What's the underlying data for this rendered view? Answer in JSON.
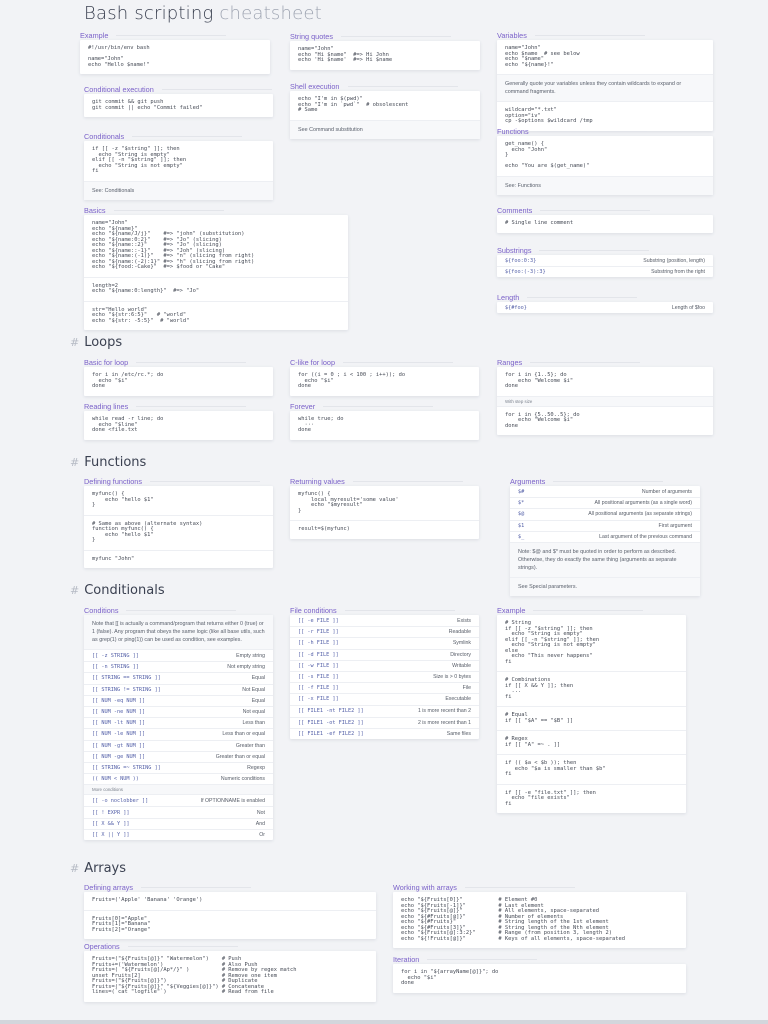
{
  "title": {
    "main": "Bash scripting",
    "sub": "cheatsheet"
  },
  "sections": {
    "hash": "#",
    "loops": "Loops",
    "functions": "Functions",
    "conditionals": "Conditionals",
    "arrays": "Arrays"
  },
  "cards": [
    {
      "id": "example",
      "title": "Example",
      "blocks": [
        {
          "type": "code",
          "lines": [
            "#!/usr/bin/env bash",
            "",
            "name=\"John\"",
            "echo \"Hello $name!\""
          ]
        }
      ]
    },
    {
      "id": "condexec",
      "title": "Conditional execution",
      "blocks": [
        {
          "type": "code",
          "lines": [
            "git commit && git push",
            "git commit || echo \"Commit failed\""
          ]
        }
      ]
    },
    {
      "id": "conditionals",
      "title": "Conditionals",
      "blocks": [
        {
          "type": "code",
          "lines": [
            "if [[ -z \"$string\" ]]; then",
            "  echo \"String is empty\"",
            "elif [[ -n \"$string\" ]]; then",
            "  echo \"String is not empty\"",
            "fi"
          ]
        },
        {
          "type": "text",
          "text": "See: Conditionals"
        }
      ]
    },
    {
      "id": "basics",
      "title": "Basics",
      "blocks": [
        {
          "type": "code",
          "lines": [
            "name=\"John\"",
            "echo \"${name}\"",
            "echo \"${name/J/j}\"    #=> \"john\" (substitution)",
            "echo \"${name:0:2}\"    #=> \"Jo\" (slicing)",
            "echo \"${name::2}\"     #=> \"Jo\" (slicing)",
            "echo \"${name::-1}\"    #=> \"Joh\" (slicing)",
            "echo \"${name:(-1)}\"   #=> \"n\" (slicing from right)",
            "echo \"${name:(-2):1}\" #=> \"h\" (slicing from right)",
            "echo \"${food:-Cake}\"  #=> $food or \"Cake\""
          ]
        },
        {
          "type": "code",
          "lines": [
            "length=2",
            "echo \"${name:0:length}\"  #=> \"Jo\""
          ]
        },
        {
          "type": "code",
          "lines": [
            "str=\"Hello world\"",
            "echo \"${str:6:5}\"   # \"world\"",
            "echo \"${str: -5:5}\"  # \"world\""
          ]
        }
      ]
    },
    {
      "id": "strquotes",
      "title": "String quotes",
      "blocks": [
        {
          "type": "code",
          "lines": [
            "name=\"John\"",
            "echo \"Hi $name\"  #=> Hi John",
            "echo 'Hi $name'  #=> Hi $name"
          ]
        }
      ]
    },
    {
      "id": "shellexec",
      "title": "Shell execution",
      "blocks": [
        {
          "type": "code",
          "lines": [
            "echo \"I'm in $(pwd)\"",
            "echo \"I'm in `pwd`\"  # obsolescent",
            "# Same"
          ]
        },
        {
          "type": "text",
          "text": "See Command substitution"
        }
      ]
    },
    {
      "id": "variables",
      "title": "Variables",
      "blocks": [
        {
          "type": "code",
          "lines": [
            "name=\"John\"",
            "echo $name  # see below",
            "echo \"$name\"",
            "echo \"${name}!\""
          ]
        },
        {
          "type": "text",
          "text": "Generally quote your variables unless they contain wildcards to expand or command fragments."
        },
        {
          "type": "code",
          "lines": [
            "wildcard=\"*.txt\"",
            "option=\"iv\"",
            "cp -$options $wildcard /tmp"
          ]
        }
      ]
    },
    {
      "id": "functions",
      "title": "Functions",
      "blocks": [
        {
          "type": "code",
          "lines": [
            "get_name() {",
            "  echo \"John\"",
            "}",
            "",
            "echo \"You are $(get_name)\""
          ]
        },
        {
          "type": "text",
          "text": "See: Functions"
        }
      ]
    },
    {
      "id": "comments",
      "title": "Comments",
      "blocks": [
        {
          "type": "code",
          "lines": [
            "# Single line comment"
          ]
        }
      ]
    },
    {
      "id": "substrings",
      "title": "Substrings",
      "blocks": [
        {
          "type": "table",
          "rows": [
            [
              "${foo:0:3}",
              "Substring (position, length)"
            ],
            [
              "${foo:(-3):3}",
              "Substring from the right"
            ]
          ]
        }
      ]
    },
    {
      "id": "length",
      "title": "Length",
      "blocks": [
        {
          "type": "table",
          "rows": [
            [
              "${#foo}",
              "Length of $foo"
            ]
          ]
        }
      ]
    },
    {
      "id": "basicfor",
      "title": "Basic for loop",
      "blocks": [
        {
          "type": "code",
          "lines": [
            "for i in /etc/rc.*; do",
            "  echo \"$i\"",
            "done"
          ]
        }
      ]
    },
    {
      "id": "readlines",
      "title": "Reading lines",
      "blocks": [
        {
          "type": "code",
          "lines": [
            "while read -r line; do",
            "  echo \"$line\"",
            "done <file.txt"
          ]
        }
      ]
    },
    {
      "id": "clike",
      "title": "C-like for loop",
      "blocks": [
        {
          "type": "code",
          "lines": [
            "for ((i = 0 ; i < 100 ; i++)); do",
            "  echo \"$i\"",
            "done"
          ]
        }
      ]
    },
    {
      "id": "forever",
      "title": "Forever",
      "blocks": [
        {
          "type": "code",
          "lines": [
            "while true; do",
            "  ···",
            "done"
          ]
        }
      ]
    },
    {
      "id": "ranges",
      "title": "Ranges",
      "blocks": [
        {
          "type": "code",
          "lines": [
            "for i in {1..5}; do",
            "    echo \"Welcome $i\"",
            "done"
          ]
        },
        {
          "type": "small",
          "text": "With step size"
        },
        {
          "type": "code",
          "lines": [
            "for i in {5..50..5}; do",
            "    echo \"Welcome $i\"",
            "done"
          ]
        }
      ]
    },
    {
      "id": "deffunc",
      "title": "Defining functions",
      "blocks": [
        {
          "type": "code",
          "lines": [
            "myfunc() {",
            "    echo \"hello $1\"",
            "}"
          ]
        },
        {
          "type": "code",
          "lines": [
            "# Same as above (alternate syntax)",
            "function myfunc() {",
            "    echo \"hello $1\"",
            "}"
          ]
        },
        {
          "type": "code",
          "lines": [
            "myfunc \"John\""
          ]
        }
      ]
    },
    {
      "id": "retvals",
      "title": "Returning values",
      "blocks": [
        {
          "type": "code",
          "lines": [
            "myfunc() {",
            "    local myresult='some value'",
            "    echo \"$myresult\"",
            "}"
          ]
        },
        {
          "type": "code",
          "lines": [
            "result=$(myfunc)"
          ]
        }
      ]
    },
    {
      "id": "arguments",
      "title": "Arguments",
      "blocks": [
        {
          "type": "table",
          "rows": [
            [
              "$#",
              "Number of arguments"
            ],
            [
              "$*",
              "All positional arguments (as a single word)"
            ],
            [
              "$@",
              "All positional arguments (as separate strings)"
            ],
            [
              "$1",
              "First argument"
            ],
            [
              "$_",
              "Last argument of the previous command"
            ]
          ]
        },
        {
          "type": "text",
          "text": "Note: $@ and $* must be quoted in order to perform as described. Otherwise, they do exactly the same thing (arguments as separate strings)."
        },
        {
          "type": "text",
          "text": "See Special parameters."
        }
      ]
    },
    {
      "id": "conditions",
      "title": "Conditions",
      "blocks": [
        {
          "type": "text",
          "text": "Note that [[ is actually a command/program that returns either 0 (true) or 1 (false). Any program that obeys the same logic (like all base utils, such as grep(1) or ping(1)) can be used as condition, see examples."
        },
        {
          "type": "table",
          "rows": [
            [
              "[[ -z STRING ]]",
              "Empty string"
            ],
            [
              "[[ -n STRING ]]",
              "Not empty string"
            ],
            [
              "[[ STRING == STRING ]]",
              "Equal"
            ],
            [
              "[[ STRING != STRING ]]",
              "Not Equal"
            ],
            [
              "[[ NUM -eq NUM ]]",
              "Equal"
            ],
            [
              "[[ NUM -ne NUM ]]",
              "Not equal"
            ],
            [
              "[[ NUM -lt NUM ]]",
              "Less than"
            ],
            [
              "[[ NUM -le NUM ]]",
              "Less than or equal"
            ],
            [
              "[[ NUM -gt NUM ]]",
              "Greater than"
            ],
            [
              "[[ NUM -ge NUM ]]",
              "Greater than or equal"
            ],
            [
              "[[ STRING =~ STRING ]]",
              "Regexp"
            ],
            [
              "(( NUM < NUM ))",
              "Numeric conditions"
            ]
          ]
        },
        {
          "type": "small",
          "text": "More conditions"
        },
        {
          "type": "table",
          "rows": [
            [
              "[[ -o noclobber ]]",
              "If OPTIONNAME is enabled"
            ],
            [
              "[[ ! EXPR ]]",
              "Not"
            ],
            [
              "[[ X && Y ]]",
              "And"
            ],
            [
              "[[ X || Y ]]",
              "Or"
            ]
          ]
        }
      ]
    },
    {
      "id": "fileconds",
      "title": "File conditions",
      "blocks": [
        {
          "type": "table",
          "rows": [
            [
              "[[ -e FILE ]]",
              "Exists"
            ],
            [
              "[[ -r FILE ]]",
              "Readable"
            ],
            [
              "[[ -h FILE ]]",
              "Symlink"
            ],
            [
              "[[ -d FILE ]]",
              "Directory"
            ],
            [
              "[[ -w FILE ]]",
              "Writable"
            ],
            [
              "[[ -s FILE ]]",
              "Size is > 0 bytes"
            ],
            [
              "[[ -f FILE ]]",
              "File"
            ],
            [
              "[[ -x FILE ]]",
              "Executable"
            ]
          ]
        },
        {
          "type": "table",
          "rows": [
            [
              "[[ FILE1 -nt FILE2 ]]",
              "1 is more recent than 2"
            ],
            [
              "[[ FILE1 -ot FILE2 ]]",
              "2 is more recent than 1"
            ],
            [
              "[[ FILE1 -ef FILE2 ]]",
              "Same files"
            ]
          ]
        }
      ]
    },
    {
      "id": "condexample",
      "title": "Example",
      "blocks": [
        {
          "type": "code",
          "lines": [
            "# String",
            "if [[ -z \"$string\" ]]; then",
            "  echo \"String is empty\"",
            "elif [[ -n \"$string\" ]]; then",
            "  echo \"String is not empty\"",
            "else",
            "  echo \"This never happens\"",
            "fi"
          ]
        },
        {
          "type": "code",
          "lines": [
            "# Combinations",
            "if [[ X && Y ]]; then",
            "  ...",
            "fi"
          ]
        },
        {
          "type": "code",
          "lines": [
            "# Equal",
            "if [[ \"$A\" == \"$B\" ]]"
          ]
        },
        {
          "type": "code",
          "lines": [
            "# Regex",
            "if [[ \"A\" =~ . ]]"
          ]
        },
        {
          "type": "code",
          "lines": [
            "if (( $a < $b )); then",
            "   echo \"$a is smaller than $b\"",
            "fi"
          ]
        },
        {
          "type": "code",
          "lines": [
            "if [[ -e \"file.txt\" ]]; then",
            "  echo \"file exists\"",
            "fi"
          ]
        }
      ]
    },
    {
      "id": "defarrays",
      "title": "Defining arrays",
      "blocks": [
        {
          "type": "code",
          "lines": [
            "Fruits=('Apple' 'Banana' 'Orange')"
          ]
        },
        {
          "type": "code",
          "lines": [
            "Fruits[0]=\"Apple\"",
            "Fruits[1]=\"Banana\"",
            "Fruits[2]=\"Orange\""
          ]
        }
      ]
    },
    {
      "id": "operations",
      "title": "Operations",
      "blocks": [
        {
          "type": "code",
          "lines": [
            "Fruits=(\"${Fruits[@]}\" \"Watermelon\")    # Push",
            "Fruits+=('Watermelon')                  # Also Push",
            "Fruits=( \"${Fruits[@]/Ap*/}\" )          # Remove by regex match",
            "unset Fruits[2]                         # Remove one item",
            "Fruits=(\"${Fruits[@]}\")                 # Duplicate",
            "Fruits=(\"${Fruits[@]}\" \"${Veggies[@]}\") # Concatenate",
            "lines=(`cat \"logfile\"`)                 # Read from file"
          ]
        }
      ]
    },
    {
      "id": "workarrays",
      "title": "Working with arrays",
      "blocks": [
        {
          "type": "code",
          "lines": [
            "echo \"${Fruits[0]}\"           # Element #0",
            "echo \"${Fruits[-1]}\"          # Last element",
            "echo \"${Fruits[@]}\"           # All elements, space-separated",
            "echo \"${#Fruits[@]}\"          # Number of elements",
            "echo \"${#Fruits}\"             # String length of the 1st element",
            "echo \"${#Fruits[3]}\"          # String length of the Nth element",
            "echo \"${Fruits[@]:3:2}\"       # Range (from position 3, length 2)",
            "echo \"${!Fruits[@]}\"          # Keys of all elements, space-separated"
          ]
        }
      ]
    },
    {
      "id": "iteration",
      "title": "Iteration",
      "blocks": [
        {
          "type": "code",
          "lines": [
            "for i in \"${arrayName[@]}\"; do",
            "  echo \"$i\"",
            "done"
          ]
        }
      ]
    }
  ]
}
